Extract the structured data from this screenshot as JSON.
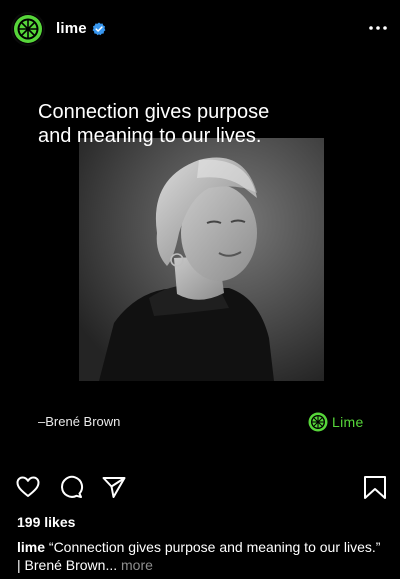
{
  "header": {
    "username": "lime",
    "avatar_icon": "lime-fruit-icon",
    "verified_icon": "verified-badge-icon",
    "more_icon": "more-options-icon"
  },
  "post": {
    "quote": "Connection gives purpose and meaning to our lives.",
    "author": "–Brené Brown",
    "brand_text": "Lime",
    "brand_color": "#57d63a",
    "photo_description_icon": "portrait-photo"
  },
  "actions": {
    "like_icon": "heart-icon",
    "comment_icon": "comment-icon",
    "share_icon": "share-icon",
    "save_icon": "bookmark-icon"
  },
  "likes": "199 likes",
  "caption": {
    "username": "lime",
    "text": " “Connection gives purpose and meaning to our lives.” | Brené Brown... ",
    "more": "more"
  },
  "colors": {
    "background": "#000000",
    "accent": "#57d63a",
    "verified": "#3897f0",
    "muted": "#8e8e8e"
  }
}
